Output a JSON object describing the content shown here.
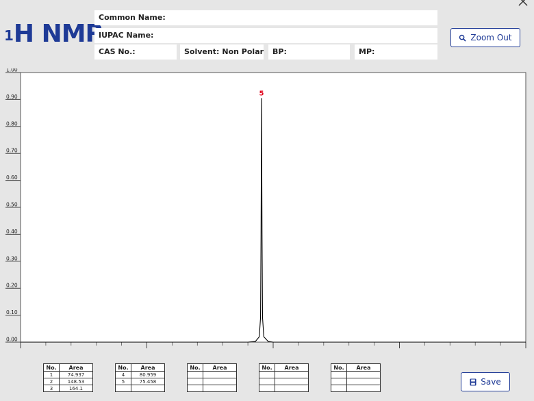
{
  "header": {
    "title_sup": "1",
    "title_main": "H NMR",
    "common_name_label": "Common Name:",
    "common_name_value": "",
    "iupac_name_label": "IUPAC Name:",
    "iupac_name_value": "",
    "cas_label": "CAS No.:",
    "cas_value": "",
    "solvent_label": "Solvent:",
    "solvent_value": "Non Polar",
    "bp_label": "BP:",
    "bp_value": "",
    "mp_label": "MP:",
    "mp_value": ""
  },
  "buttons": {
    "zoom_out_label": "Zoom Out",
    "save_label": "Save",
    "zoom_icon": "magnifier-icon",
    "save_icon": "floppy-disk-icon",
    "close_icon": "close-icon"
  },
  "chart_data": {
    "type": "line",
    "title": "",
    "xlabel": "",
    "ylabel": "",
    "xlim": [
      6.0,
      4.0
    ],
    "ylim": [
      0.0,
      1.0
    ],
    "x_ticks": [
      "6.0",
      "5.5",
      "5.0",
      "4.5",
      "4.0"
    ],
    "y_ticks": [
      "0.00",
      "0.10",
      "0.20",
      "0.30",
      "0.40",
      "0.50",
      "0.60",
      "0.70",
      "0.80",
      "0.90",
      "1.00"
    ],
    "grid": false,
    "series": [
      {
        "points": [
          [
            6.0,
            0.0
          ],
          [
            5.1,
            0.0
          ],
          [
            5.07,
            0.003
          ],
          [
            5.055,
            0.02
          ],
          [
            5.05,
            0.09
          ],
          [
            5.048,
            0.4
          ],
          [
            5.046,
            0.905
          ],
          [
            5.044,
            0.4
          ],
          [
            5.042,
            0.09
          ],
          [
            5.037,
            0.02
          ],
          [
            5.02,
            0.003
          ],
          [
            5.0,
            0.0
          ],
          [
            4.0,
            0.0
          ]
        ]
      }
    ],
    "peak_labels": [
      {
        "label": "5",
        "x": 5.046,
        "y": 0.905
      }
    ],
    "colors": {
      "line": "#000000",
      "peak_label": "#e0001b"
    }
  },
  "peak_tables": [
    {
      "headers": [
        "No.",
        "Area"
      ],
      "rows": [
        [
          "1",
          "74.937"
        ],
        [
          "2",
          "148.53"
        ],
        [
          "3",
          "164.1"
        ]
      ]
    },
    {
      "headers": [
        "No.",
        "Area"
      ],
      "rows": [
        [
          "4",
          "80.959"
        ],
        [
          "5",
          "75.458"
        ],
        [
          "",
          ""
        ]
      ]
    },
    {
      "headers": [
        "No.",
        "Area"
      ],
      "rows": [
        [
          "",
          ""
        ],
        [
          "",
          ""
        ],
        [
          "",
          ""
        ]
      ]
    },
    {
      "headers": [
        "No.",
        "Area"
      ],
      "rows": [
        [
          "",
          ""
        ],
        [
          "",
          ""
        ],
        [
          "",
          ""
        ]
      ]
    },
    {
      "headers": [
        "No.",
        "Area"
      ],
      "rows": [
        [
          "",
          ""
        ],
        [
          "",
          ""
        ],
        [
          "",
          ""
        ]
      ]
    }
  ]
}
